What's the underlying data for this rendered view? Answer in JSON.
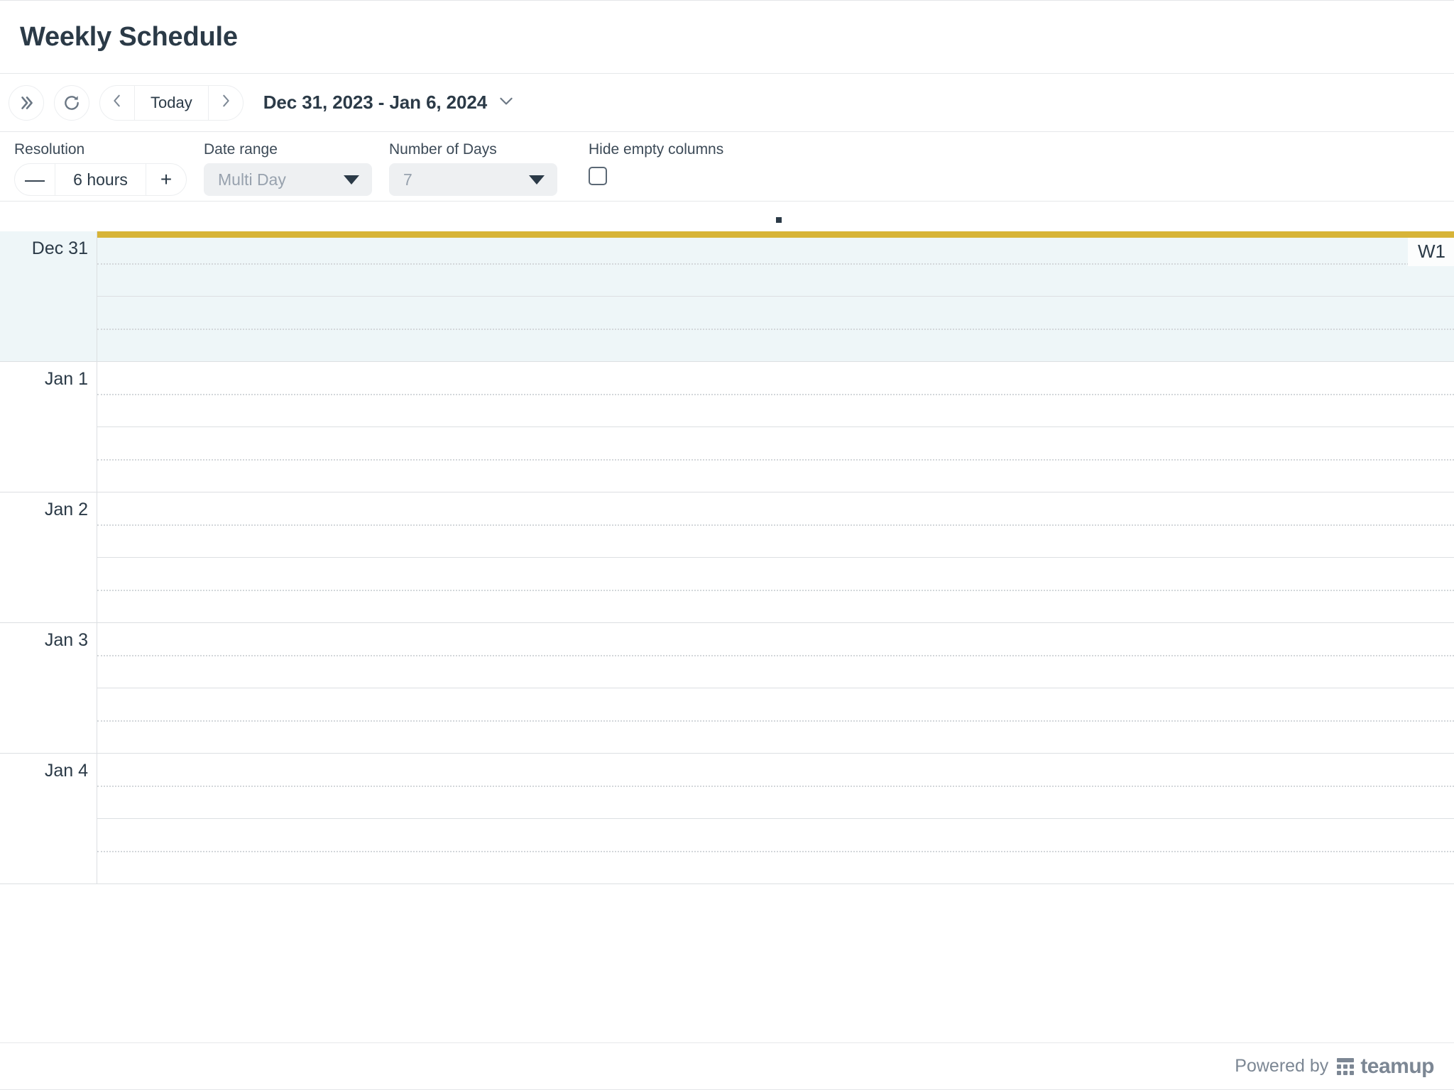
{
  "header": {
    "title": "Weekly Schedule"
  },
  "toolbar": {
    "expand_icon": "chevron-double-right-icon",
    "refresh_icon": "refresh-icon",
    "prev_icon": "chevron-left-icon",
    "next_icon": "chevron-right-icon",
    "today_label": "Today",
    "range_label": "Dec 31, 2023 - Jan 6, 2024",
    "range_caret_icon": "chevron-down-icon"
  },
  "filters": {
    "resolution": {
      "label": "Resolution",
      "value": "6 hours",
      "decrement_label": "—",
      "increment_label": "+"
    },
    "date_range": {
      "label": "Date range",
      "value": "Multi Day",
      "caret_icon": "caret-down-icon"
    },
    "number_of_days": {
      "label": "Number of Days",
      "value": "7",
      "caret_icon": "caret-down-icon"
    },
    "hide_empty_columns": {
      "label": "Hide empty columns",
      "checked": false
    }
  },
  "calendar": {
    "week_badge": "W1",
    "today_index": 0,
    "days": [
      {
        "label": "Dec 31",
        "is_today": true
      },
      {
        "label": "Jan 1",
        "is_today": false
      },
      {
        "label": "Jan 2",
        "is_today": false
      },
      {
        "label": "Jan 3",
        "is_today": false
      },
      {
        "label": "Jan 4",
        "is_today": false
      }
    ]
  },
  "footer": {
    "powered_by": "Powered by",
    "brand": "teamup",
    "brand_icon": "teamup-dots-icon"
  },
  "colors": {
    "today_highlight": "#eef6f8",
    "today_bar": "#d7b437",
    "text_primary": "#2b3a47",
    "text_muted": "#98a2ae",
    "border": "#dcdfe2",
    "control_bg": "#eef0f2"
  }
}
